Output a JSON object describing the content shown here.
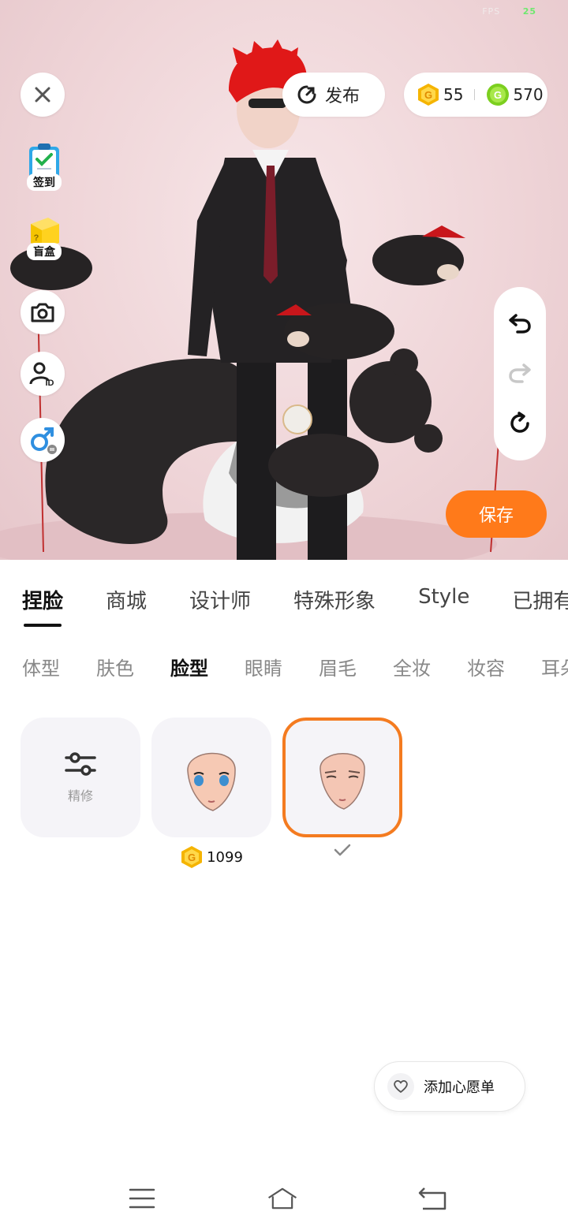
{
  "status": {
    "fps_label": "FPS",
    "fps_value": "25"
  },
  "header": {
    "publish_label": "发布",
    "gold_coins": "55",
    "green_coins": "570"
  },
  "side": {
    "checkin_label": "签到",
    "blindbox_label": "盲盒"
  },
  "save_label": "保存",
  "tabs": [
    {
      "label": "捏脸",
      "active": true
    },
    {
      "label": "商城"
    },
    {
      "label": "设计师"
    },
    {
      "label": "特殊形象"
    },
    {
      "label": "Style"
    },
    {
      "label": "已拥有"
    }
  ],
  "subtabs": [
    {
      "label": "体型"
    },
    {
      "label": "肤色"
    },
    {
      "label": "脸型",
      "active": true
    },
    {
      "label": "眼睛"
    },
    {
      "label": "眉毛"
    },
    {
      "label": "全妆"
    },
    {
      "label": "妆容"
    },
    {
      "label": "耳朵"
    }
  ],
  "cards": {
    "refine_label": "精修",
    "item1_price": "1099"
  },
  "wishlist_label": "添加心愿单",
  "colors": {
    "accent": "#ff7a1a",
    "gold": "#f5b400",
    "green": "#7ccf1f"
  }
}
